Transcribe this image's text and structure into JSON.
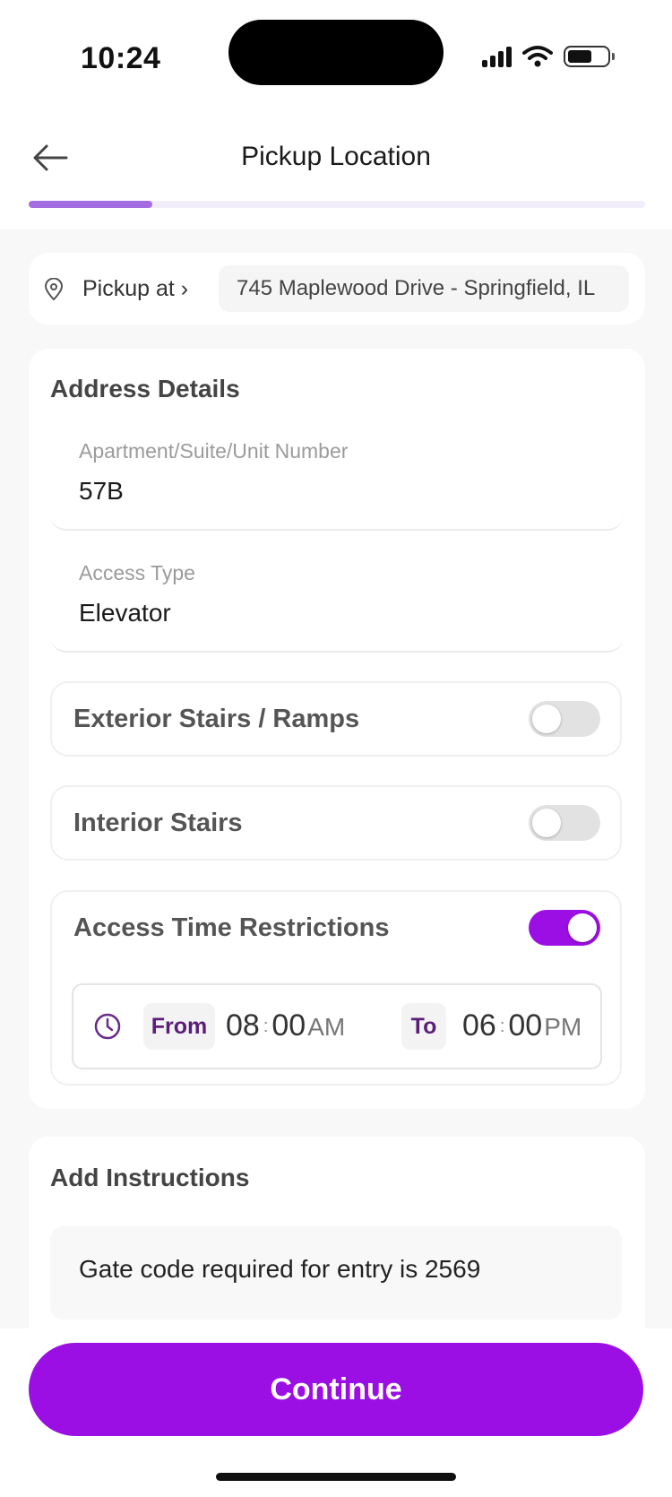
{
  "status_bar": {
    "time": "10:24"
  },
  "header": {
    "title": "Pickup Location",
    "progress_fraction": 0.2
  },
  "pickup": {
    "label": "Pickup at ›",
    "address": "745 Maplewood Drive - Springfield, IL"
  },
  "address_details": {
    "title": "Address Details",
    "unit": {
      "label": "Apartment/Suite/Unit Number",
      "value": "57B"
    },
    "access_type": {
      "label": "Access Type",
      "value": "Elevator"
    },
    "exterior_stairs": {
      "label": "Exterior Stairs / Ramps",
      "enabled": false
    },
    "interior_stairs": {
      "label": "Interior Stairs",
      "enabled": false
    },
    "time_restrictions": {
      "label": "Access Time Restrictions",
      "enabled": true,
      "from_label": "From",
      "from_hour": "08",
      "from_minute": "00",
      "from_period": "AM",
      "to_label": "To",
      "to_hour": "06",
      "to_minute": "00",
      "to_period": "PM"
    }
  },
  "instructions": {
    "title": "Add Instructions",
    "text": "Gate code required for entry is 2569"
  },
  "footer": {
    "continue_label": "Continue"
  },
  "colors": {
    "accent": "#9b0fe5",
    "progress": "#a56de2",
    "tag_text": "#5a1e7a"
  }
}
